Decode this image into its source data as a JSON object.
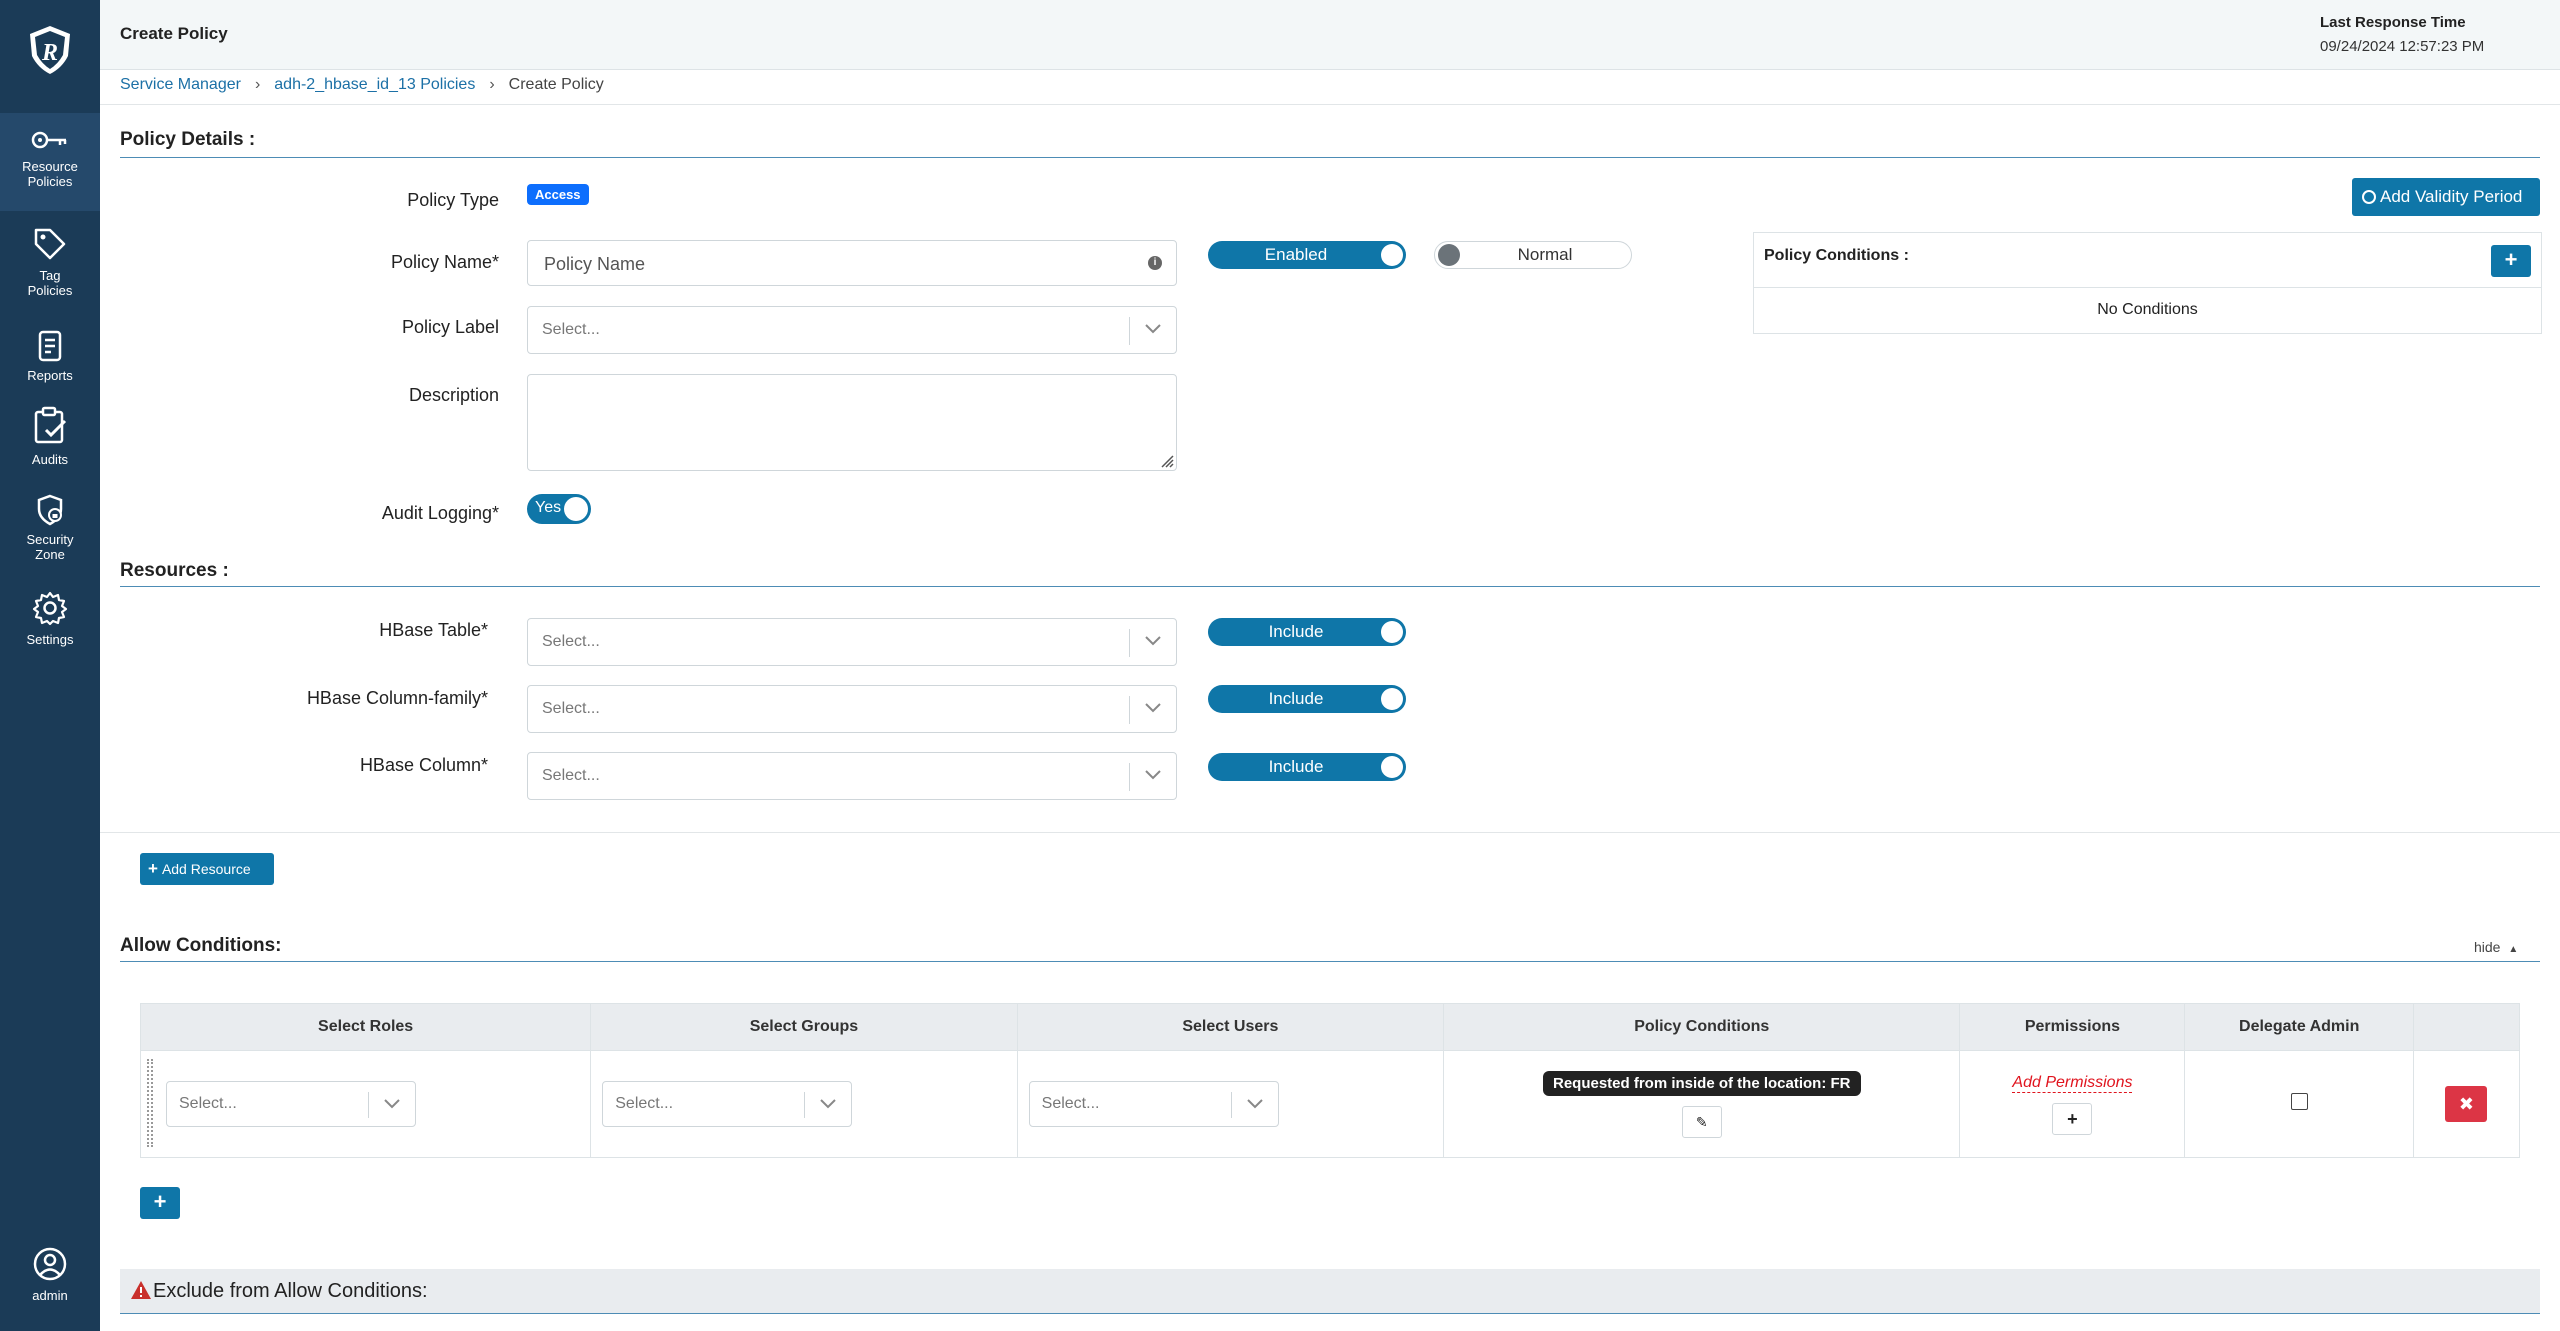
{
  "sidebar": {
    "items": [
      {
        "label_line1": "Resource",
        "label_line2": "Policies",
        "icon": "key-icon"
      },
      {
        "label_line1": "Tag",
        "label_line2": "Policies",
        "icon": "tag-icon"
      },
      {
        "label_line1": "Reports",
        "label_line2": "",
        "icon": "report-icon"
      },
      {
        "label_line1": "Audits",
        "label_line2": "",
        "icon": "clipboard-check-icon"
      },
      {
        "label_line1": "Security",
        "label_line2": "Zone",
        "icon": "shield-lock-icon"
      },
      {
        "label_line1": "Settings",
        "label_line2": "",
        "icon": "gear-icon"
      }
    ],
    "user": {
      "label": "admin",
      "icon": "user-circle-icon"
    }
  },
  "header": {
    "title": "Create Policy",
    "last_response_label": "Last Response Time",
    "last_response_value": "09/24/2024 12:57:23 PM"
  },
  "breadcrumb": {
    "items": [
      "Service Manager",
      "adh-2_hbase_id_13 Policies",
      "Create Policy"
    ]
  },
  "policy_details": {
    "title": "Policy Details :",
    "policy_type_label": "Policy Type",
    "policy_type_badge": "Access",
    "add_validity_label": "Add Validity Period",
    "policy_name_label": "Policy Name*",
    "policy_name_placeholder": "Policy Name",
    "enabled_toggle": "Enabled",
    "normal_toggle": "Normal",
    "policy_label_label": "Policy Label",
    "policy_label_placeholder": "Select...",
    "description_label": "Description",
    "audit_label": "Audit Logging*",
    "audit_toggle": "Yes",
    "conditions_title": "Policy Conditions :",
    "conditions_empty": "No Conditions"
  },
  "resources": {
    "title": "Resources :",
    "rows": [
      {
        "label": "HBase Table*",
        "placeholder": "Select...",
        "toggle": "Include"
      },
      {
        "label": "HBase Column-family*",
        "placeholder": "Select...",
        "toggle": "Include"
      },
      {
        "label": "HBase Column*",
        "placeholder": "Select...",
        "toggle": "Include"
      }
    ],
    "add_button": "Add Resource"
  },
  "allow_conditions": {
    "title": "Allow Conditions:",
    "hide_label": "hide",
    "columns": [
      "Select Roles",
      "Select Groups",
      "Select Users",
      "Policy Conditions",
      "Permissions",
      "Delegate Admin",
      ""
    ],
    "row": {
      "roles_placeholder": "Select...",
      "groups_placeholder": "Select...",
      "users_placeholder": "Select...",
      "condition_tag": "Requested from inside of the location: FR",
      "permissions_link": "Add Permissions",
      "delegate_admin": false
    }
  },
  "exclude": {
    "title": "Exclude from Allow Conditions:"
  },
  "colors": {
    "sidebar": "#1b3b57",
    "primary": "#0f76a8",
    "danger": "#dc3545",
    "link": "#1c70a6"
  }
}
